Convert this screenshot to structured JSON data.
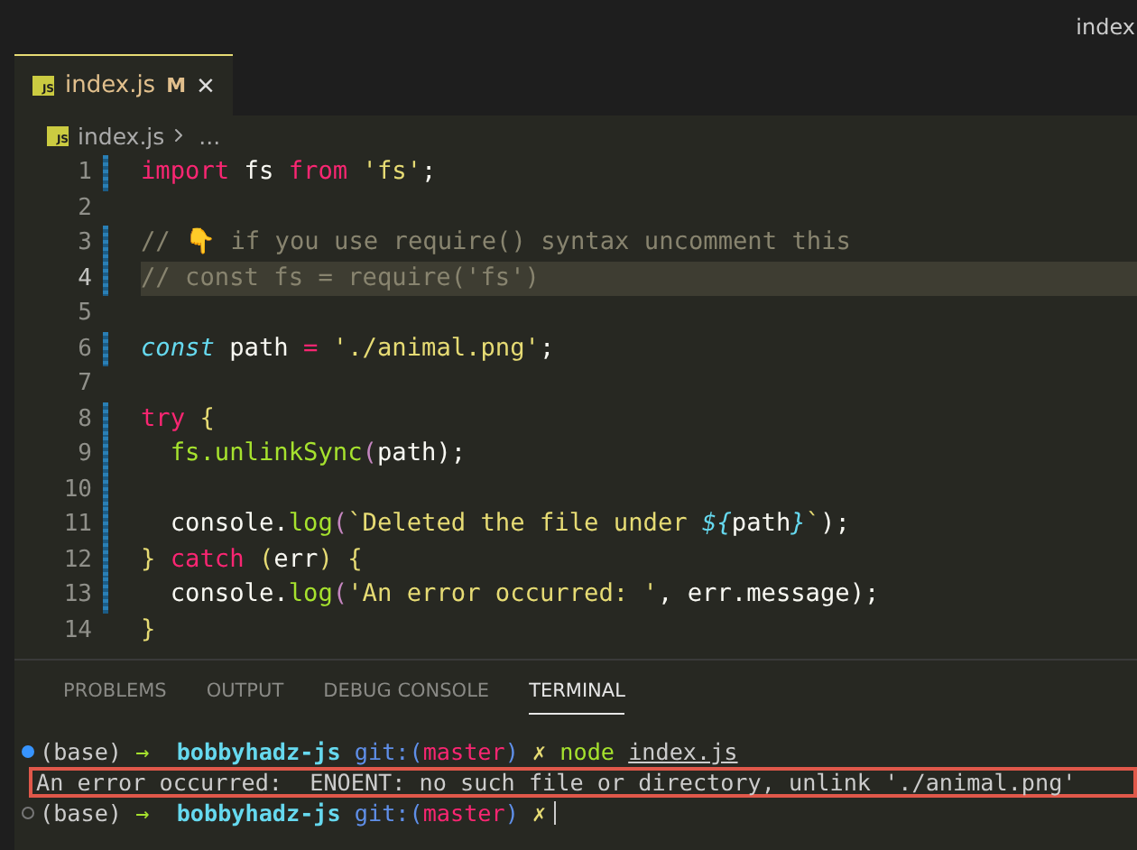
{
  "window": {
    "title": "index"
  },
  "tabs": [
    {
      "icon_label": "JS",
      "label": "index.js",
      "badge": "M",
      "close": "×",
      "selected": true
    }
  ],
  "breadcrumb": {
    "icon_label": "JS",
    "file": "index.js",
    "rest": "..."
  },
  "code_lines": [
    {
      "number": "1",
      "changed": true,
      "current": false,
      "tokens": [
        {
          "t": "import",
          "kind": "keyword"
        },
        {
          "t": " fs ",
          "kind": "plain"
        },
        {
          "t": "from",
          "kind": "keyword"
        },
        {
          "t": " 'fs'",
          "kind": "string"
        },
        {
          "t": ";",
          "kind": "plain"
        }
      ]
    },
    {
      "number": "2",
      "changed": false,
      "current": false
    },
    {
      "number": "3",
      "changed": true,
      "current": false,
      "tokens": [
        {
          "t": "// 👇 if you use require() syntax uncomment this",
          "kind": "comment"
        }
      ]
    },
    {
      "number": "4",
      "changed": true,
      "current": true,
      "tokens": [
        {
          "t": "// const fs = require('fs')",
          "kind": "comment"
        }
      ]
    },
    {
      "number": "5",
      "changed": false,
      "current": false
    },
    {
      "number": "6",
      "changed": true,
      "current": false,
      "tokens": [
        {
          "t": "const",
          "kind": "storage"
        },
        {
          "t": " path ",
          "kind": "plain"
        },
        {
          "t": "=",
          "kind": "keyword"
        },
        {
          "t": " './animal.png'",
          "kind": "string"
        },
        {
          "t": ";",
          "kind": "plain"
        }
      ]
    },
    {
      "number": "7",
      "changed": false,
      "current": false
    },
    {
      "number": "8",
      "changed": true,
      "current": false,
      "tokens": [
        {
          "t": "try",
          "kind": "keyword"
        },
        {
          "t": " {",
          "kind": "bracket"
        }
      ]
    },
    {
      "number": "9",
      "changed": true,
      "current": false,
      "tokens": [
        {
          "t": "  fs",
          "kind": "function"
        },
        {
          "t": ".unlinkSync",
          "kind": "function"
        },
        {
          "t": "(",
          "kind": "paren"
        },
        {
          "t": "path",
          "kind": "plain"
        },
        {
          "t": ");",
          "kind": "plain"
        }
      ]
    },
    {
      "number": "10",
      "changed": true,
      "current": false
    },
    {
      "number": "11",
      "changed": true,
      "current": false,
      "tokens": [
        {
          "t": "  console.",
          "kind": "plain"
        },
        {
          "t": "log",
          "kind": "function"
        },
        {
          "t": "(",
          "kind": "paren"
        },
        {
          "t": "`Deleted the file under ",
          "kind": "string"
        },
        {
          "t": "${",
          "kind": "storage"
        },
        {
          "t": "path",
          "kind": "plain"
        },
        {
          "t": "}",
          "kind": "storage"
        },
        {
          "t": "`",
          "kind": "string"
        },
        {
          "t": ");",
          "kind": "plain"
        }
      ]
    },
    {
      "number": "12",
      "changed": true,
      "current": false,
      "tokens": [
        {
          "t": "} ",
          "kind": "bracket"
        },
        {
          "t": "catch",
          "kind": "keyword"
        },
        {
          "t": " (",
          "kind": "bracket"
        },
        {
          "t": "err",
          "kind": "plain"
        },
        {
          "t": ") {",
          "kind": "bracket"
        }
      ]
    },
    {
      "number": "13",
      "changed": true,
      "current": false,
      "tokens": [
        {
          "t": "  console.",
          "kind": "plain"
        },
        {
          "t": "log",
          "kind": "function"
        },
        {
          "t": "(",
          "kind": "paren"
        },
        {
          "t": "'An error occurred: '",
          "kind": "string"
        },
        {
          "t": ", err.message",
          "kind": "plain"
        },
        {
          "t": ");",
          "kind": "plain"
        }
      ]
    },
    {
      "number": "14",
      "changed": false,
      "current": false,
      "tokens": [
        {
          "t": "}",
          "kind": "bracket"
        }
      ]
    }
  ],
  "panel_tabs": [
    {
      "label": "PROBLEMS",
      "selected": false
    },
    {
      "label": "OUTPUT",
      "selected": false
    },
    {
      "label": "DEBUG CONSOLE",
      "selected": false
    },
    {
      "label": "TERMINAL",
      "selected": true
    }
  ],
  "terminal_lines": [
    {
      "kind": "prompt",
      "done": true,
      "highlighted": false,
      "segments": [
        {
          "t": "(base) ",
          "kind": "plain"
        },
        {
          "t": "→  ",
          "kind": "arrow"
        },
        {
          "t": "bobbyhadz-js ",
          "kind": "dir"
        },
        {
          "t": "git:(",
          "kind": "git"
        },
        {
          "t": "master",
          "kind": "branch"
        },
        {
          "t": ") ",
          "kind": "git"
        },
        {
          "t": "✗ ",
          "kind": "mark"
        },
        {
          "t": "node ",
          "kind": "command"
        },
        {
          "t": "index.js",
          "kind": "underlined"
        }
      ]
    },
    {
      "kind": "output",
      "highlighted": true,
      "segments": [
        {
          "t": "An error occurred:  ENOENT: no such file or directory, unlink './animal.png'",
          "kind": "plain"
        }
      ]
    },
    {
      "kind": "prompt",
      "done": false,
      "highlighted": false,
      "segments": [
        {
          "t": "(base) ",
          "kind": "plain"
        },
        {
          "t": "→  ",
          "kind": "arrow"
        },
        {
          "t": "bobbyhadz-js ",
          "kind": "dir"
        },
        {
          "t": "git:(",
          "kind": "git"
        },
        {
          "t": "master",
          "kind": "branch"
        },
        {
          "t": ") ",
          "kind": "git"
        },
        {
          "t": "✗",
          "kind": "mark"
        }
      ]
    }
  ]
}
